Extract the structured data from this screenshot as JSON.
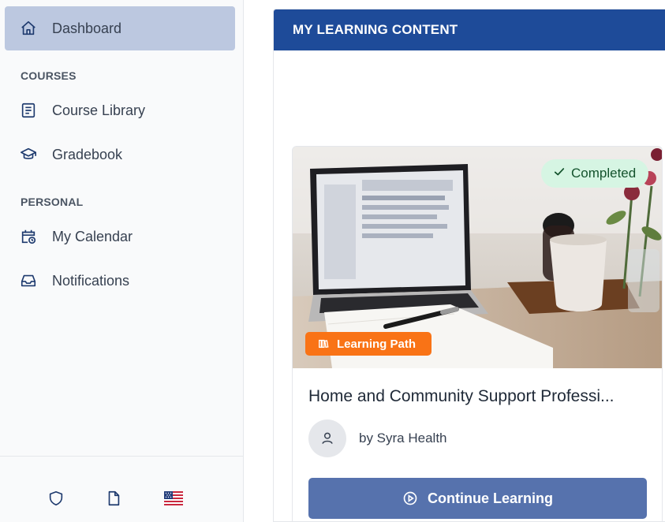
{
  "sidebar": {
    "dashboard_label": "Dashboard",
    "sections": [
      {
        "title": "COURSES",
        "items": [
          {
            "label": "Course Library",
            "icon": "book-icon"
          },
          {
            "label": "Gradebook",
            "icon": "graduation-cap-icon"
          }
        ]
      },
      {
        "title": "PERSONAL",
        "items": [
          {
            "label": "My Calendar",
            "icon": "calendar-clock-icon"
          },
          {
            "label": "Notifications",
            "icon": "inbox-icon"
          }
        ]
      }
    ],
    "footer_icons": [
      "shield-icon",
      "document-icon",
      "us-flag-icon"
    ]
  },
  "main": {
    "panel_title": "MY LEARNING CONTENT",
    "card": {
      "status_badge": "Completed",
      "type_badge": "Learning Path",
      "title": "Home and Community Support Professi...",
      "author": "by Syra Health",
      "button_label": "Continue Learning"
    }
  },
  "colors": {
    "header_blue": "#1e4b99",
    "active_nav": "#bcc8e0",
    "button_blue": "#5672ad",
    "badge_orange": "#f97316",
    "badge_green_bg": "#d6f5e3"
  }
}
